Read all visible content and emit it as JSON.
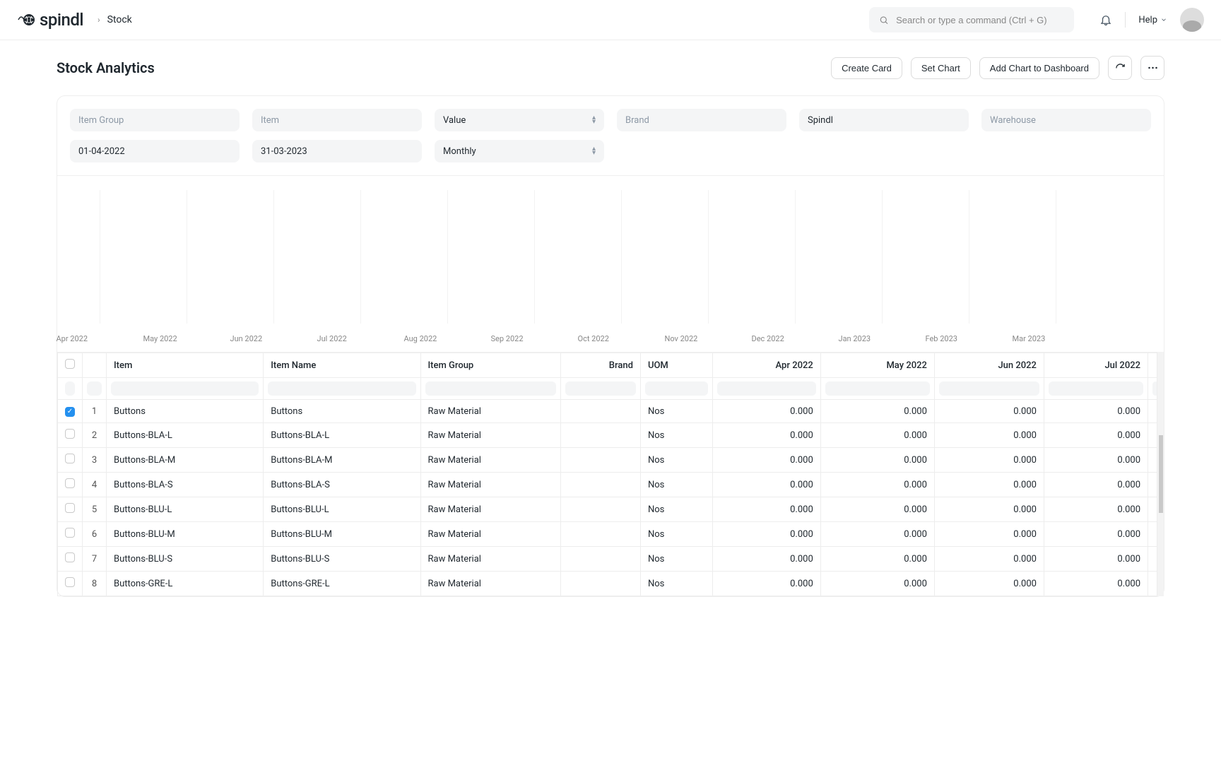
{
  "brand_name": "spindl",
  "breadcrumb": {
    "item": "Stock"
  },
  "search": {
    "placeholder": "Search or type a command (Ctrl + G)"
  },
  "help_label": "Help",
  "page_title": "Stock Analytics",
  "actions": {
    "create_card": "Create Card",
    "set_chart": "Set Chart",
    "add_dashboard": "Add Chart to Dashboard"
  },
  "filters": {
    "item_group_ph": "Item Group",
    "item_ph": "Item",
    "value_type": "Value",
    "brand_ph": "Brand",
    "company": "Spindl",
    "warehouse_ph": "Warehouse",
    "date_from": "01-04-2022",
    "date_to": "31-03-2023",
    "range": "Monthly"
  },
  "chart_data": {
    "type": "bar",
    "categories": [
      "Apr 2022",
      "May 2022",
      "Jun 2022",
      "Jul 2022",
      "Aug 2022",
      "Sep 2022",
      "Oct 2022",
      "Nov 2022",
      "Dec 2022",
      "Jan 2023",
      "Feb 2023",
      "Mar 2023"
    ],
    "values": [
      0,
      0,
      0,
      0,
      0,
      0,
      0,
      0,
      0,
      0,
      0,
      0
    ],
    "title": "",
    "xlabel": "",
    "ylabel": "",
    "ylim": [
      0,
      0
    ]
  },
  "table": {
    "headers": {
      "item": "Item",
      "item_name": "Item Name",
      "item_group": "Item Group",
      "brand": "Brand",
      "uom": "UOM",
      "m1": "Apr 2022",
      "m2": "May 2022",
      "m3": "Jun 2022",
      "m4": "Jul 2022"
    },
    "rows": [
      {
        "idx": "1",
        "checked": true,
        "item": "Buttons",
        "item_name": "Buttons",
        "item_group": "Raw Material",
        "brand": "",
        "uom": "Nos",
        "m1": "0.000",
        "m2": "0.000",
        "m3": "0.000",
        "m4": "0.000"
      },
      {
        "idx": "2",
        "checked": false,
        "item": "Buttons-BLA-L",
        "item_name": "Buttons-BLA-L",
        "item_group": "Raw Material",
        "brand": "",
        "uom": "Nos",
        "m1": "0.000",
        "m2": "0.000",
        "m3": "0.000",
        "m4": "0.000"
      },
      {
        "idx": "3",
        "checked": false,
        "item": "Buttons-BLA-M",
        "item_name": "Buttons-BLA-M",
        "item_group": "Raw Material",
        "brand": "",
        "uom": "Nos",
        "m1": "0.000",
        "m2": "0.000",
        "m3": "0.000",
        "m4": "0.000"
      },
      {
        "idx": "4",
        "checked": false,
        "item": "Buttons-BLA-S",
        "item_name": "Buttons-BLA-S",
        "item_group": "Raw Material",
        "brand": "",
        "uom": "Nos",
        "m1": "0.000",
        "m2": "0.000",
        "m3": "0.000",
        "m4": "0.000"
      },
      {
        "idx": "5",
        "checked": false,
        "item": "Buttons-BLU-L",
        "item_name": "Buttons-BLU-L",
        "item_group": "Raw Material",
        "brand": "",
        "uom": "Nos",
        "m1": "0.000",
        "m2": "0.000",
        "m3": "0.000",
        "m4": "0.000"
      },
      {
        "idx": "6",
        "checked": false,
        "item": "Buttons-BLU-M",
        "item_name": "Buttons-BLU-M",
        "item_group": "Raw Material",
        "brand": "",
        "uom": "Nos",
        "m1": "0.000",
        "m2": "0.000",
        "m3": "0.000",
        "m4": "0.000"
      },
      {
        "idx": "7",
        "checked": false,
        "item": "Buttons-BLU-S",
        "item_name": "Buttons-BLU-S",
        "item_group": "Raw Material",
        "brand": "",
        "uom": "Nos",
        "m1": "0.000",
        "m2": "0.000",
        "m3": "0.000",
        "m4": "0.000"
      },
      {
        "idx": "8",
        "checked": false,
        "item": "Buttons-GRE-L",
        "item_name": "Buttons-GRE-L",
        "item_group": "Raw Material",
        "brand": "",
        "uom": "Nos",
        "m1": "0.000",
        "m2": "0.000",
        "m3": "0.000",
        "m4": "0.000"
      }
    ]
  }
}
